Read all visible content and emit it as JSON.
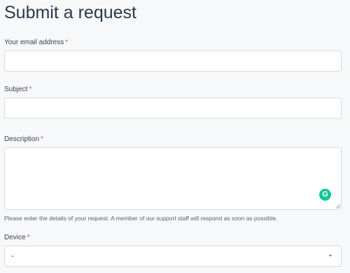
{
  "page": {
    "title": "Submit a request"
  },
  "form": {
    "email": {
      "label": "Your email address",
      "required_mark": "*",
      "value": "",
      "placeholder": ""
    },
    "subject": {
      "label": "Subject",
      "required_mark": "*",
      "value": "",
      "placeholder": ""
    },
    "description": {
      "label": "Description",
      "required_mark": "*",
      "value": "",
      "placeholder": "",
      "hint": "Please enter the details of your request. A member of our support staff will respond as soon as possible.",
      "grammarly_glyph": "G"
    },
    "device": {
      "label": "Device",
      "required_mark": "*",
      "selected": "-"
    }
  },
  "colors": {
    "required": "#d9534f",
    "grammarly": "#15c39a",
    "background": "#f6f8fa"
  },
  "icons": {
    "grammarly": "grammarly-icon",
    "resize": "resize-handle-icon",
    "dropdown": "chevron-down-icon"
  }
}
